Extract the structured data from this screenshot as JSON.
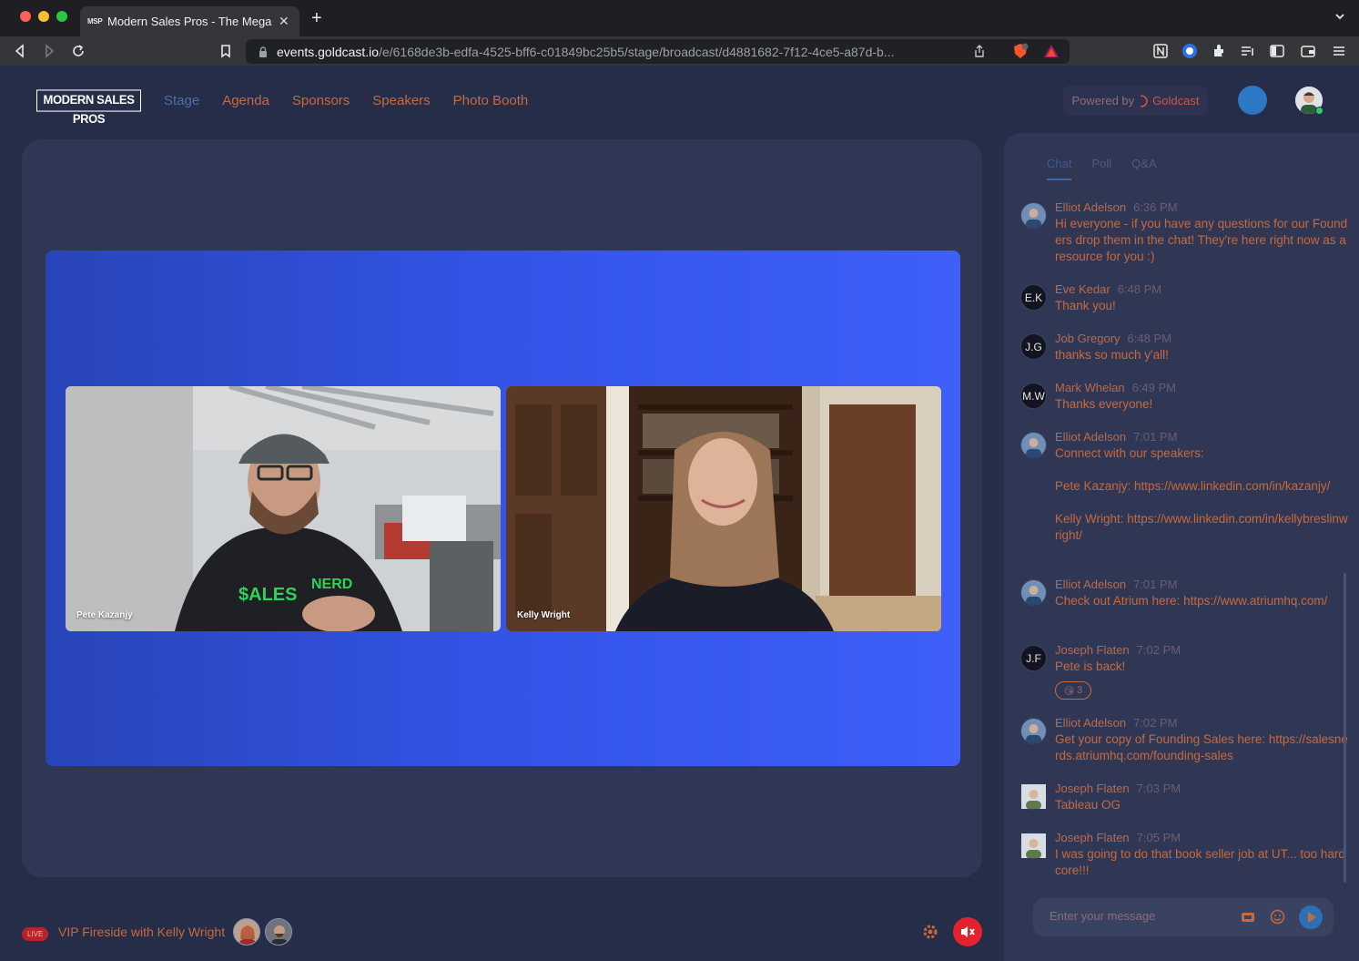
{
  "browser": {
    "tab_favicon": "MSP",
    "tab_title": "Modern Sales Pros - The Mega",
    "url_host": "events.goldcast.io",
    "url_path": "/e/6168de3b-edfa-4525-bff6-c01849bc25b5/stage/broadcast/d4881682-7f12-4ce5-a87d-b...",
    "icons": [
      "back-icon",
      "forward-icon",
      "reload-icon",
      "bookmark-icon",
      "lock-icon",
      "share-icon",
      "brave-shield-icon",
      "brave-rewards-icon",
      "extensions-icon",
      "sidebar-icon",
      "wallet-icon",
      "menu-icon"
    ]
  },
  "header": {
    "logo": "MODERN SALES PROS",
    "nav": [
      "Stage",
      "Agenda",
      "Sponsors",
      "Speakers",
      "Photo Booth"
    ],
    "active_nav": "Stage",
    "powered_by": "Powered by",
    "powered_brand": "Goldcast"
  },
  "stage": {
    "videos": [
      {
        "name": "Pete Kazanjy"
      },
      {
        "name": "Kelly Wright"
      }
    ]
  },
  "bottom": {
    "live_badge": "LIVE",
    "session_title": "VIP Fireside with Kelly Wright"
  },
  "chat": {
    "tabs": [
      "Chat",
      "Poll",
      "Q&A"
    ],
    "active_tab": "Chat",
    "messages": [
      {
        "initials": "",
        "name": "Elliot Adelson",
        "time": "6:36 PM",
        "text": "Hi everyone - if you have any questions for our Founders drop them in the chat! They're here right now as a resource for you :)"
      },
      {
        "initials": "E.K",
        "name": "Eve Kedar",
        "time": "6:48 PM",
        "text": "Thank you!"
      },
      {
        "initials": "J.G",
        "name": "Job Gregory",
        "time": "6:48 PM",
        "text": "thanks so much y'all!"
      },
      {
        "initials": "M.W",
        "name": "Mark Whelan",
        "time": "6:49 PM",
        "text": "Thanks everyone!"
      },
      {
        "initials": "",
        "name": "Elliot Adelson",
        "time": "7:01 PM",
        "text": "Connect with our speakers:\n\nPete Kazanjy: https://www.linkedin.com/in/kazanjy/\n\nKelly Wright: https://www.linkedin.com/in/kellybreslinwright/"
      },
      {
        "initials": "",
        "name": "Elliot Adelson",
        "time": "7:01 PM",
        "text": "Check out Atrium here: https://www.atriumhq.com/"
      },
      {
        "initials": "J.F",
        "name": "Joseph Flaten",
        "time": "7:02 PM",
        "text": "Pete is back!",
        "reaction": "😘",
        "reaction_count": "3"
      },
      {
        "initials": "",
        "name": "Elliot Adelson",
        "time": "7:02 PM",
        "text": "Get your copy of Founding Sales here: https://salesnerds.atriumhq.com/founding-sales"
      },
      {
        "initials": "",
        "name": "Joseph Flaten",
        "time": "7:03 PM",
        "text": "Tableau OG"
      },
      {
        "initials": "",
        "name": "Joseph Flaten",
        "time": "7:05 PM",
        "text": "I was going to do that book seller job at UT... too hardcore!!!"
      }
    ],
    "input_placeholder": "Enter your message"
  },
  "colors": {
    "background": "#262d48",
    "panel": "#2f3754",
    "accent_text": "#c7693e",
    "stage_blue": "#3454e8",
    "mute_red": "#e2232f"
  }
}
